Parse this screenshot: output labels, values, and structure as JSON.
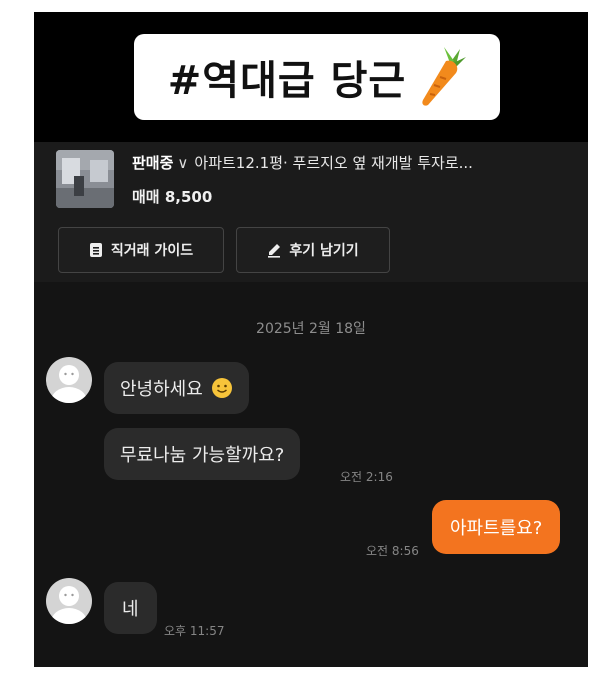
{
  "banner": {
    "text": "#역대급 당근",
    "icon": "carrot-icon"
  },
  "product": {
    "status_label": "판매중",
    "status_chevron": "chevron-down-icon",
    "title": "아파트12.1평· 푸르지오 옆 재개발 투자로...",
    "price": "매매 8,500",
    "thumbnail": "apartment-interior-photo"
  },
  "actions": {
    "guide_label": "직거래 가이드",
    "guide_icon": "document-icon",
    "review_label": "후기 남기기",
    "review_icon": "pencil-icon"
  },
  "chat": {
    "date": "2025년 2월 18일",
    "messages": [
      {
        "sender": "other",
        "text": "안녕하세요",
        "emoji": "smiley-icon"
      },
      {
        "sender": "other",
        "text": "무료나눔 가능할까요?",
        "time": "오전 2:16"
      },
      {
        "sender": "me",
        "text": "아파트를요?",
        "time": "오전 8:56"
      },
      {
        "sender": "other",
        "text": "네",
        "time": "오후 11:57"
      }
    ]
  },
  "colors": {
    "background": "#141414",
    "accent": "#f3741f",
    "bubble_other": "#2b2b2b",
    "banner_bg": "#ffffff"
  }
}
